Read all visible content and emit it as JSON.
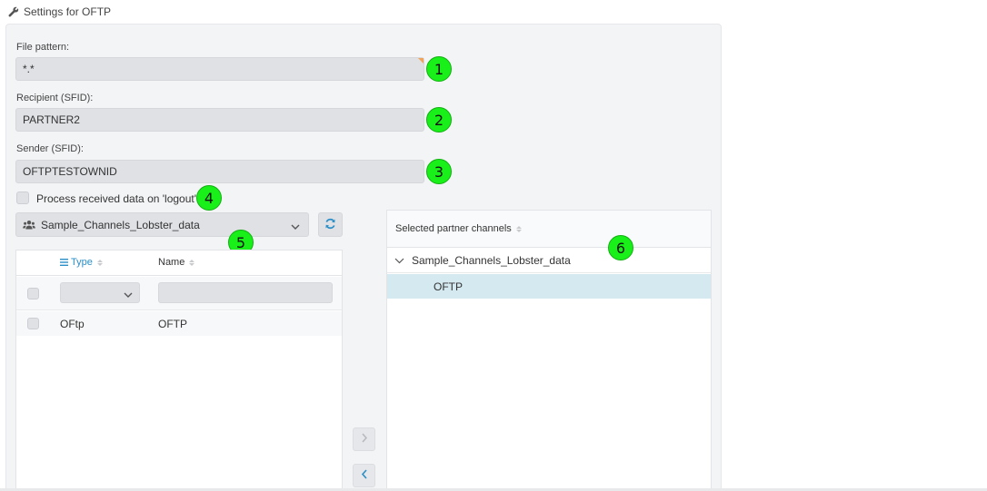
{
  "window": {
    "title": "Settings for OFTP"
  },
  "form": {
    "file_pattern": {
      "label": "File pattern:",
      "value": "*.*"
    },
    "recipient": {
      "label": "Recipient (SFID):",
      "value": "PARTNER2"
    },
    "sender": {
      "label": "Sender (SFID):",
      "value": "OFTPTESTOWNID"
    },
    "logout_checkbox": {
      "label": "Process received data on 'logout'",
      "checked": false
    }
  },
  "channel_selector": {
    "selected": "Sample_Channels_Lobster_data",
    "icon": "users-icon"
  },
  "left_table": {
    "columns": [
      {
        "label": "Type",
        "icon": "list-icon"
      },
      {
        "label": "Name"
      }
    ],
    "rows": [
      {
        "type": "OFtp",
        "name": "OFTP"
      }
    ]
  },
  "right_table": {
    "header": "Selected partner channels",
    "group": "Sample_Channels_Lobster_data",
    "items": [
      "OFTP"
    ]
  },
  "markers": [
    "1",
    "2",
    "3",
    "4",
    "5",
    "6"
  ],
  "colors": {
    "accent": "#2b8fc7",
    "marker": "#19ef19",
    "selected_row": "#d4e9f0",
    "input_bg": "#dfe1e5"
  }
}
